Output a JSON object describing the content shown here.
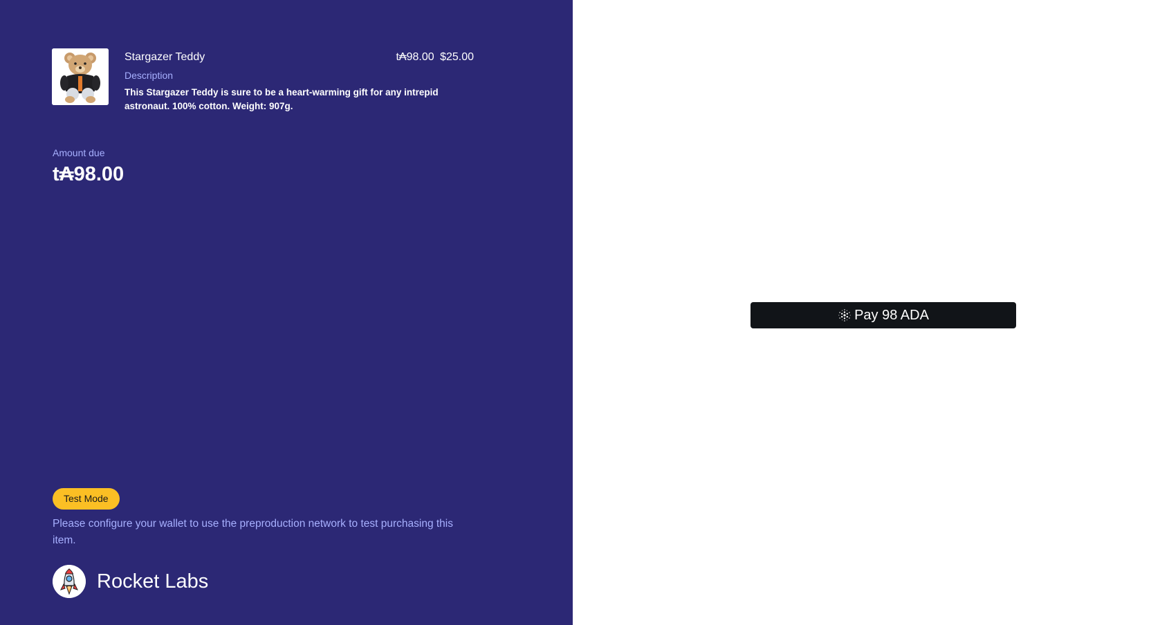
{
  "product": {
    "name": "Stargazer Teddy",
    "original_price": "t₳98.00",
    "price": "$25.00",
    "description_label": "Description",
    "description": "This Stargazer Teddy is sure to be a heart-warming gift for any intrepid astronaut. 100% cotton. Weight: 907g.",
    "image": "teddy-bear-product-photo"
  },
  "amount": {
    "label": "Amount due",
    "value": "t₳98.00"
  },
  "test_mode": {
    "badge": "Test Mode",
    "note": "Please configure your wallet to use the preproduction network to test purchasing this item."
  },
  "brand": {
    "name": "Rocket Labs",
    "logo": "rocket-icon"
  },
  "payment": {
    "button_label": "Pay 98 ADA",
    "icon": "cardano-icon"
  },
  "colors": {
    "left_panel": "#2c2875",
    "accent_label": "#a7b0ff",
    "badge": "#fbbf24",
    "pay_button": "#111418"
  }
}
